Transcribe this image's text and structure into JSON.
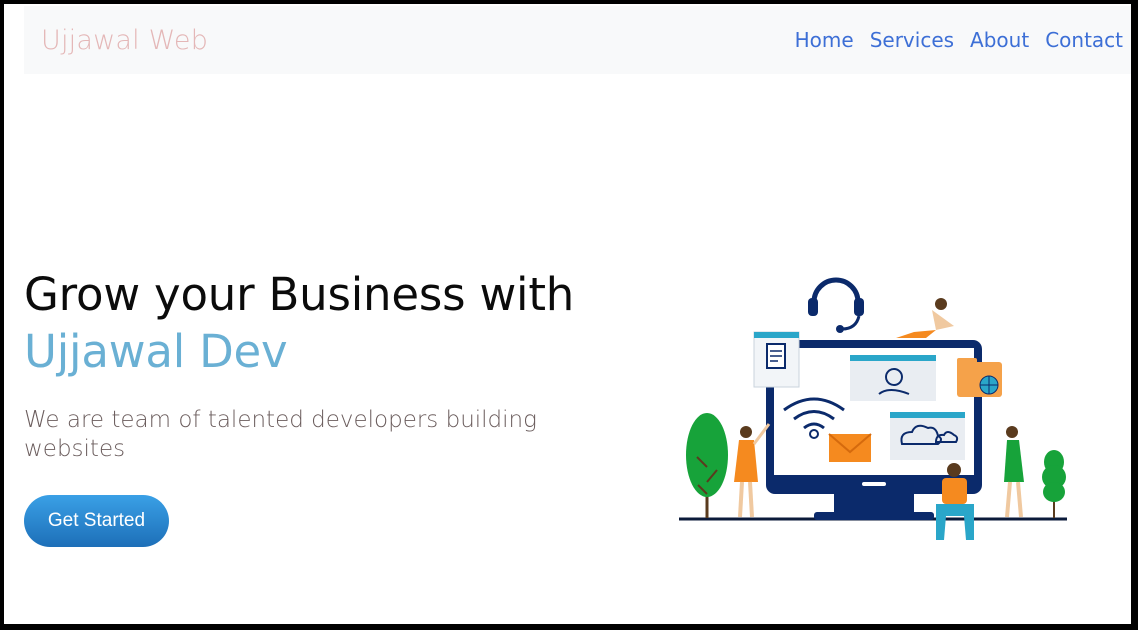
{
  "navbar": {
    "brand": "Ujjawal Web",
    "links": [
      "Home",
      "Services",
      "About",
      "Contact"
    ]
  },
  "hero": {
    "title_line1": "Grow your Business with",
    "title_accent": "Ujjawal Dev",
    "subtitle": "We are team of talented developers building websites",
    "cta_label": "Get Started"
  },
  "colors": {
    "brand": "#e4b7b7",
    "nav_link": "#3d6fd6",
    "accent": "#6ab0d4",
    "button": "#2a86d0",
    "monitor": "#0b2a6b",
    "orange": "#f58a1f",
    "green": "#1aa33a"
  },
  "illustration": {
    "icons": [
      "headset-icon",
      "document-icon",
      "gear-hand-icon",
      "folder-globe-icon",
      "wifi-icon",
      "mail-icon",
      "cloud-icon",
      "tree-icon",
      "person-icon"
    ]
  }
}
